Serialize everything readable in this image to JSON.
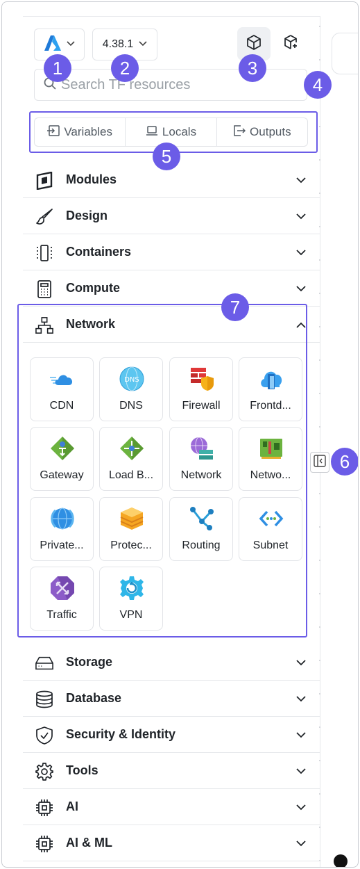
{
  "toolbar": {
    "version": "4.38.1",
    "provider_icon": "azure-logo"
  },
  "search": {
    "placeholder": "Search TF resources",
    "value": ""
  },
  "segments": [
    {
      "label": "Variables",
      "icon": "variables-icon"
    },
    {
      "label": "Locals",
      "icon": "laptop-icon"
    },
    {
      "label": "Outputs",
      "icon": "export-icon"
    }
  ],
  "categories_top": [
    {
      "label": "Modules",
      "icon": "module-icon"
    },
    {
      "label": "Design",
      "icon": "brush-icon"
    },
    {
      "label": "Containers",
      "icon": "container-icon"
    },
    {
      "label": "Compute",
      "icon": "calculator-icon"
    }
  ],
  "network": {
    "label": "Network",
    "icon": "network-icon",
    "items": [
      {
        "label": "CDN",
        "icon": "cdn-icon"
      },
      {
        "label": "DNS",
        "icon": "dns-icon"
      },
      {
        "label": "Firewall",
        "icon": "firewall-icon"
      },
      {
        "label": "Frontd...",
        "icon": "front-door-icon"
      },
      {
        "label": "Gateway",
        "icon": "gateway-icon"
      },
      {
        "label": "Load B...",
        "icon": "load-balancer-icon"
      },
      {
        "label": "Network",
        "icon": "virtual-network-icon"
      },
      {
        "label": "Netwo...",
        "icon": "network-interface-icon"
      },
      {
        "label": "Private...",
        "icon": "private-link-icon"
      },
      {
        "label": "Protec...",
        "icon": "protection-icon"
      },
      {
        "label": "Routing",
        "icon": "routing-icon"
      },
      {
        "label": "Subnet",
        "icon": "subnet-icon"
      },
      {
        "label": "Traffic",
        "icon": "traffic-manager-icon"
      },
      {
        "label": "VPN",
        "icon": "vpn-icon"
      }
    ]
  },
  "categories_bottom": [
    {
      "label": "Storage",
      "icon": "storage-icon"
    },
    {
      "label": "Database",
      "icon": "database-icon"
    },
    {
      "label": "Security & Identity",
      "icon": "shield-icon"
    },
    {
      "label": "Tools",
      "icon": "gear-icon"
    },
    {
      "label": "AI",
      "icon": "chip-icon"
    },
    {
      "label": "AI & ML",
      "icon": "chip-icon"
    }
  ],
  "annotations": [
    "1",
    "2",
    "3",
    "4",
    "5",
    "6",
    "7"
  ],
  "colors": {
    "accent": "#6b5ce7",
    "border": "#e2e4e8",
    "text": "#1f2328"
  }
}
